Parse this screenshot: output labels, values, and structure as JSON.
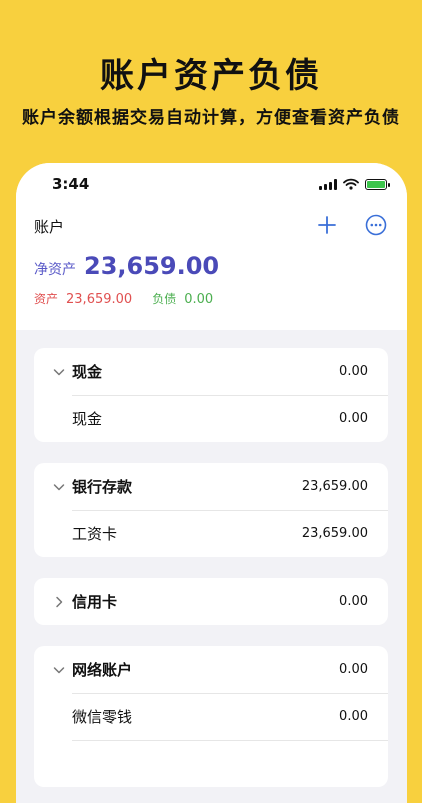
{
  "hero": {
    "title": "账户资产负债",
    "subtitle": "账户余额根据交易自动计算，方便查看资产负债"
  },
  "status_bar": {
    "time": "3:44"
  },
  "header": {
    "title": "账户",
    "add_icon": "plus-icon",
    "more_icon": "ellipsis-circle-icon"
  },
  "summary": {
    "net_label": "净资产",
    "net_value": "23,659.00",
    "asset_label": "资产",
    "asset_value": "23,659.00",
    "liability_label": "负债",
    "liability_value": "0.00"
  },
  "colors": {
    "background": "#f8d03e",
    "net": "#4a4ab8",
    "asset": "#e05050",
    "liability": "#4caf50",
    "accent": "#3a6fd8"
  },
  "groups": [
    {
      "name": "现金",
      "total": "0.00",
      "expanded": true,
      "accounts": [
        {
          "name": "现金",
          "amount": "0.00"
        }
      ]
    },
    {
      "name": "银行存款",
      "total": "23,659.00",
      "expanded": true,
      "accounts": [
        {
          "name": "工资卡",
          "amount": "23,659.00"
        }
      ]
    },
    {
      "name": "信用卡",
      "total": "0.00",
      "expanded": false,
      "accounts": []
    },
    {
      "name": "网络账户",
      "total": "0.00",
      "expanded": true,
      "accounts": [
        {
          "name": "微信零钱",
          "amount": "0.00"
        }
      ]
    }
  ]
}
